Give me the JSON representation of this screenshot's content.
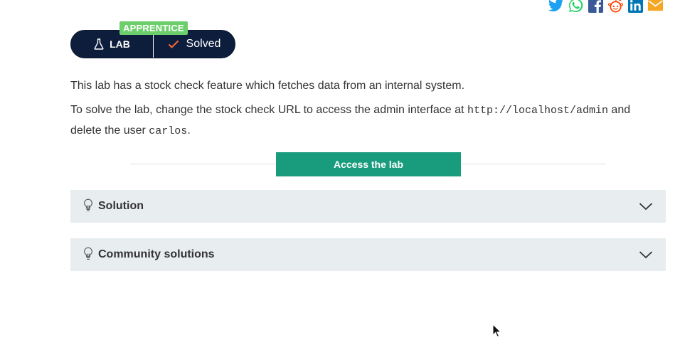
{
  "share": {
    "icons": [
      "twitter-icon",
      "whatsapp-icon",
      "facebook-icon",
      "reddit-icon",
      "linkedin-icon",
      "email-icon"
    ],
    "colors": {
      "twitter": "#1da1f2",
      "whatsapp": "#25d366",
      "facebook": "#3b5998",
      "reddit": "#ff4500",
      "linkedin": "#0077b5",
      "email": "#f5a623"
    }
  },
  "lab_status": {
    "level": "APPRENTICE",
    "lab_label": "LAB",
    "status_label": "Solved",
    "colors": {
      "pill": "#0d1e3d",
      "level_tag": "#6ccf6c",
      "check": "#ff6633"
    }
  },
  "description": {
    "line1": "This lab has a stock check feature which fetches data from an internal system.",
    "line2_prefix": "To solve the lab, change the stock check URL to access the admin interface at ",
    "line2_code": "http://localhost/admin",
    "line2_mid": " and delete the user ",
    "line2_user": "carlos",
    "line2_suffix": "."
  },
  "access_button": {
    "label": "Access the lab",
    "color": "#199b7d"
  },
  "panels": [
    {
      "title": "Solution",
      "icon": "lightbulb-icon"
    },
    {
      "title": "Community solutions",
      "icon": "lightbulb-icon"
    }
  ]
}
